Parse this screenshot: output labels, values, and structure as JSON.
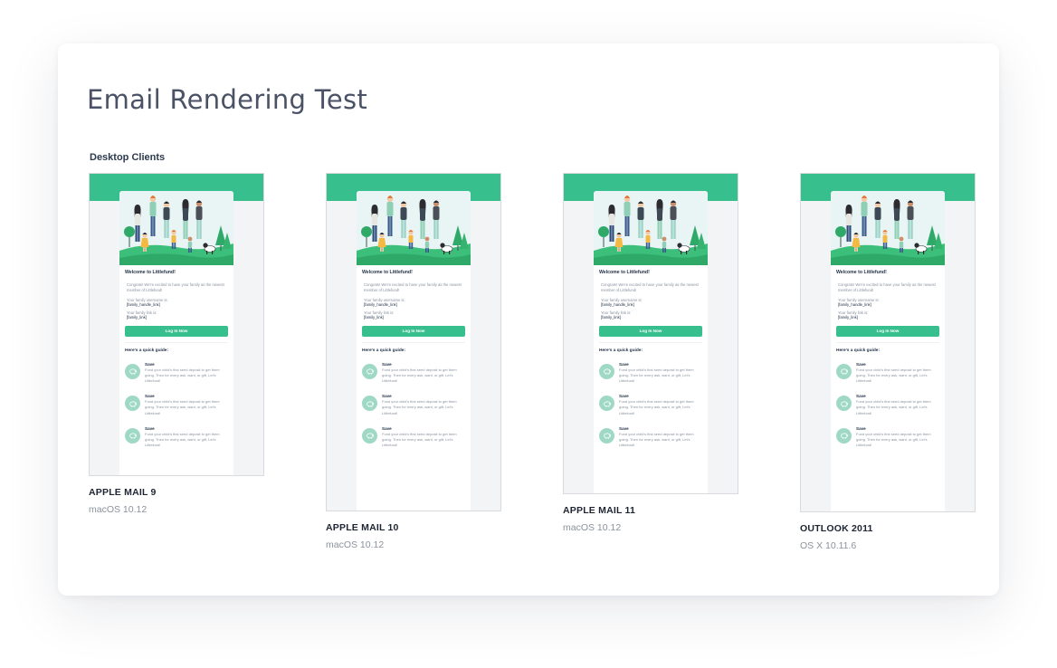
{
  "page_title": "Email Rendering Test",
  "section_label": "Desktop Clients",
  "colors": {
    "accent": "#38bf8e",
    "title_text": "#4b5266",
    "heading_text": "#1e2532",
    "muted_text": "#8b929c"
  },
  "email_preview": {
    "welcome": "Welcome to Littlefund!",
    "intro": "Congrats! We're excited to have your family as the newest member of Littlefund!",
    "username_label": "Your family username is:",
    "username_value": "[family_handle_link]",
    "link_label": "Your family link is:",
    "link_value": "[family_link]",
    "button_label": "Log In Now",
    "guide_heading": "Here's a quick guide:",
    "steps": [
      {
        "title": "Save",
        "text": "Fund your child's first seed deposit to get them going. Then for every ask, want, or gift, Let's Littlefund!",
        "icon": "piggy-bank-icon"
      },
      {
        "title": "Save",
        "text": "Fund your child's first seed deposit to get them going. Then for every ask, want, or gift, Let's Littlefund!",
        "icon": "piggy-bank-icon"
      },
      {
        "title": "Save",
        "text": "Fund your child's first seed deposit to get them going. Then for every ask, want, or gift, Let's Littlefund!",
        "icon": "piggy-bank-icon"
      }
    ]
  },
  "clients": [
    {
      "name": "APPLE MAIL 9",
      "os": "macOS 10.12"
    },
    {
      "name": "APPLE MAIL 10",
      "os": "macOS 10.12"
    },
    {
      "name": "APPLE MAIL 11",
      "os": "macOS 10.12"
    },
    {
      "name": "OUTLOOK 2011",
      "os": "OS X 10.11.6"
    }
  ]
}
